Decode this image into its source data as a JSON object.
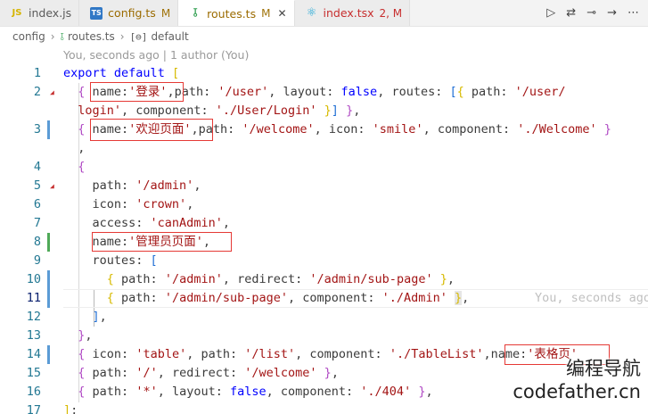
{
  "tabs": [
    {
      "label": "index.js",
      "status": "",
      "icon": "js-icon",
      "active": false
    },
    {
      "label": "config.ts",
      "status": "M",
      "icon": "ts-icon",
      "active": false
    },
    {
      "label": "routes.ts",
      "status": "M",
      "icon": "route-icon",
      "active": true
    },
    {
      "label": "index.tsx",
      "status": "2, M",
      "icon": "react-icon",
      "active": false
    }
  ],
  "tab_actions": [
    "run-icon",
    "compare-changes-icon",
    "timeline-icon",
    "forward-icon",
    "more-icon"
  ],
  "breadcrumb": {
    "folder": "config",
    "file": "routes.ts",
    "symbol": "default"
  },
  "blame": "You, seconds ago | 1 author (You)",
  "lines": [
    {
      "n": "1"
    },
    {
      "n": "2"
    },
    {
      "n": ""
    },
    {
      "n": "3"
    },
    {
      "n": ""
    },
    {
      "n": "4"
    },
    {
      "n": "5"
    },
    {
      "n": "6"
    },
    {
      "n": "7"
    },
    {
      "n": "8"
    },
    {
      "n": "9"
    },
    {
      "n": "10"
    },
    {
      "n": "11"
    },
    {
      "n": "12"
    },
    {
      "n": "13"
    },
    {
      "n": "14"
    },
    {
      "n": "15"
    },
    {
      "n": "16"
    },
    {
      "n": "17"
    }
  ],
  "ghost_text": "You, seconds ago",
  "watermark": {
    "line1": "编程导航",
    "line2": "codefather.cn"
  },
  "colors": {
    "keyword": "#0000ff",
    "string": "#a31515",
    "line_number": "#237893",
    "highlight_box": "#e53935",
    "git_added": "#4fa958",
    "git_modified": "#5b9bd5"
  }
}
